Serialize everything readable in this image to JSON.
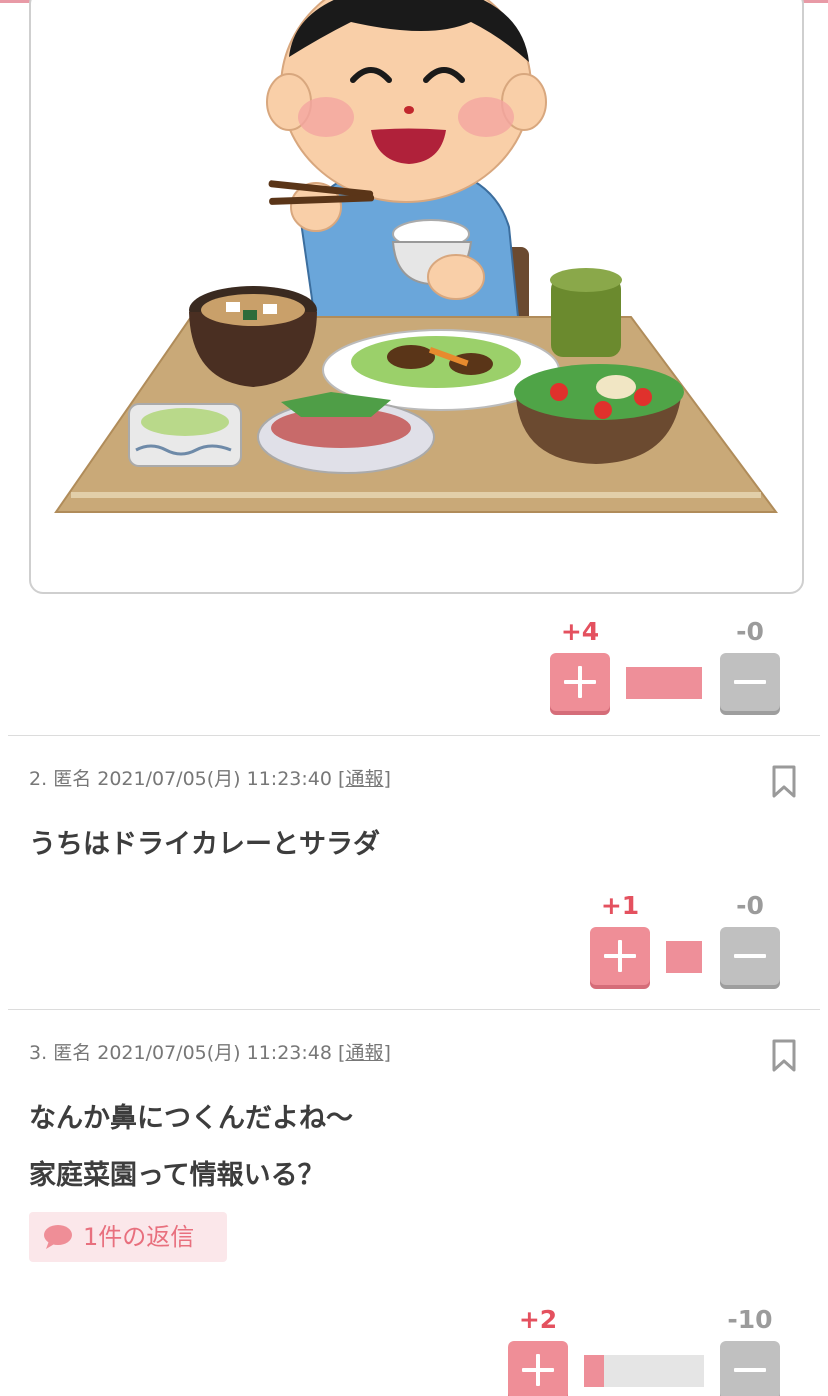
{
  "posts": [
    {
      "votes": {
        "plus_label": "+4",
        "minus_label": "-0",
        "plus_ratio": 1.0
      }
    },
    {
      "number": "2.",
      "author": "匿名",
      "datetime": "2021/07/05(月) 11:23:40",
      "report_label": "通報",
      "lines": [
        "うちはドライカレーとサラダ"
      ],
      "votes": {
        "plus_label": "+1",
        "minus_label": "-0",
        "plus_ratio": 1.0
      }
    },
    {
      "number": "3.",
      "author": "匿名",
      "datetime": "2021/07/05(月) 11:23:48",
      "report_label": "通報",
      "lines": [
        "なんか鼻につくんだよね〜",
        "家庭菜園って情報いる？"
      ],
      "reply_label": "1件の返信",
      "votes": {
        "plus_label": "+2",
        "minus_label": "-10",
        "plus_ratio": 0.17
      }
    }
  ],
  "colors": {
    "accent": "#e4515f",
    "plus_button": "#ef8e97",
    "minus_button": "#c0c0c0",
    "bar_bg": "#e5e5e5"
  },
  "icons": {
    "bookmark": "bookmark-icon",
    "reply": "speech-bubble-icon",
    "plus": "plus-icon",
    "minus": "minus-icon"
  }
}
